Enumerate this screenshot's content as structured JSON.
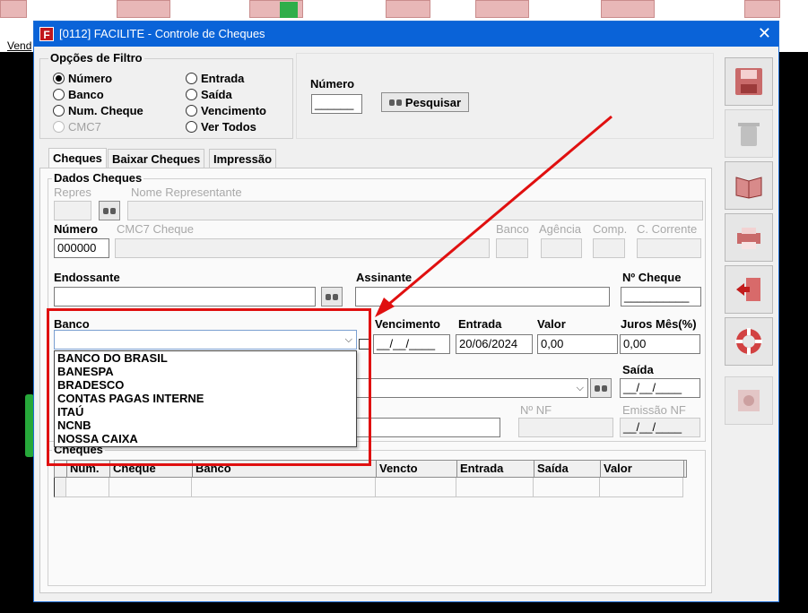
{
  "background": {
    "menu_text": "Vend"
  },
  "window": {
    "title": "[0112] FACILITE - Controle de Cheques",
    "app_icon": "F",
    "close": "✕"
  },
  "filter": {
    "legend": "Opções de Filtro",
    "options": [
      "Número",
      "Banco",
      "Num. Cheque",
      "CMC7",
      "Entrada",
      "Saída",
      "Vencimento",
      "Ver Todos"
    ],
    "selected": "Número"
  },
  "search": {
    "number_label": "Número",
    "number_value": "______",
    "button_label": "Pesquisar"
  },
  "tabs": [
    "Cheques",
    "Baixar Cheques",
    "Impressão"
  ],
  "dados": {
    "legend": "Dados Cheques",
    "repres_label": "Repres",
    "nome_rep_label": "Nome Representante",
    "numero_label": "Número",
    "numero_value": "000000",
    "cmc7_label": "CMC7 Cheque",
    "banco_label_small": "Banco",
    "agencia_label": "Agência",
    "comp_label": "Comp.",
    "conta_label": "C. Corrente",
    "endossante_label": "Endossante",
    "assinante_label": "Assinante",
    "ncheque_label": "Nº Cheque",
    "ncheque_value": "__________",
    "banco_label": "Banco",
    "vencimento_label": "Vencimento",
    "vencimento_value": "__/__/____",
    "entrada_label": "Entrada",
    "entrada_value": "20/06/2024",
    "valor_label": "Valor",
    "valor_value": "0,00",
    "juros_label": "Juros Mês(%)",
    "juros_value": "0,00",
    "saida_label": "Saída",
    "saida_value": "__/__/____",
    "nnf_label": "Nº NF",
    "emissao_label": "Emissão NF",
    "emissao_value": "__/__/____"
  },
  "bank_dropdown": [
    "BANCO DO BRASIL",
    "BANESPA",
    "BRADESCO",
    "CONTAS PAGAS INTERNE",
    "ITAÚ",
    "NCNB",
    "NOSSA CAIXA"
  ],
  "cheques_grid": {
    "legend": "Cheques",
    "columns": [
      "Num.",
      "Cheque",
      "Banco",
      "Vencto",
      "Entrada",
      "Saída",
      "Valor"
    ]
  },
  "colors": {
    "title_bar": "#0a63d8",
    "highlight": "#e01010",
    "arrow": "#e01010"
  }
}
